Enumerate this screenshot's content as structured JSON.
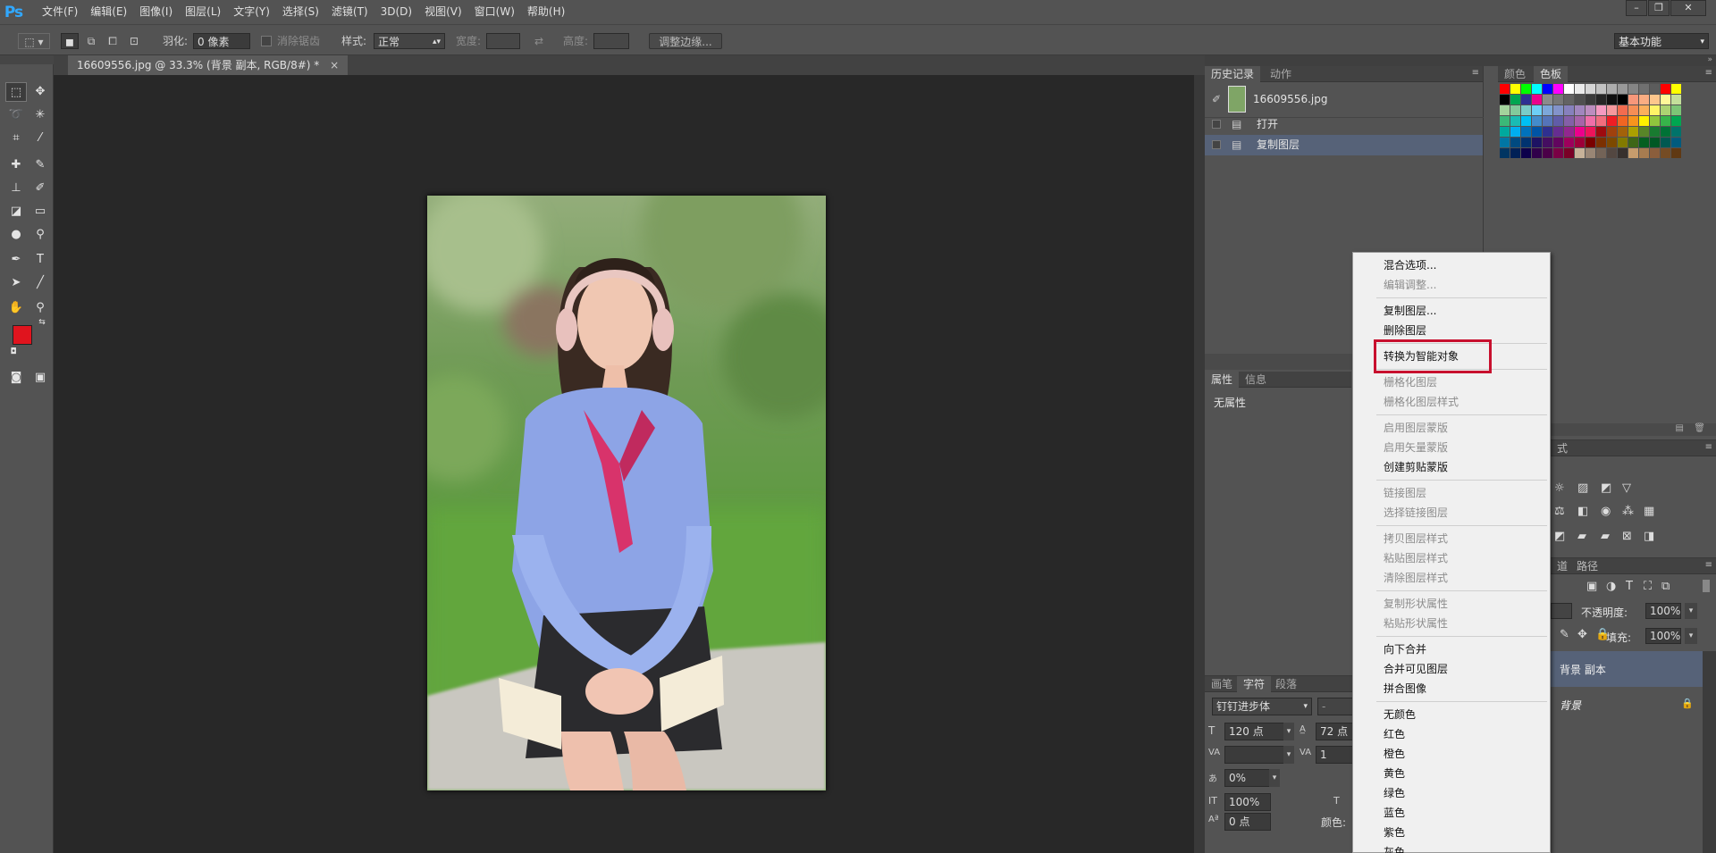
{
  "app": {
    "logo": "Ps"
  },
  "menu": [
    "文件(F)",
    "编辑(E)",
    "图像(I)",
    "图层(L)",
    "文字(Y)",
    "选择(S)",
    "滤镜(T)",
    "3D(D)",
    "视图(V)",
    "窗口(W)",
    "帮助(H)"
  ],
  "window_controls": {
    "minimize": "–",
    "restore": "❐",
    "close": "✕"
  },
  "options_bar": {
    "feather_label": "羽化:",
    "feather_value": "0 像素",
    "anti_alias_label": "消除锯齿",
    "style_label": "样式:",
    "style_value": "正常",
    "width_label": "宽度:",
    "height_label": "高度:",
    "refine_edge_button": "调整边缘...",
    "workspace_value": "基本功能"
  },
  "document": {
    "tab_title": "16609556.jpg @ 33.3% (背景 副本, RGB/8#) *",
    "close_glyph": "×"
  },
  "history_panel": {
    "tabs": [
      "历史记录",
      "动作"
    ],
    "snapshot_name": "16609556.jpg",
    "items": [
      "打开",
      "复制图层"
    ],
    "selected_index": 1
  },
  "swatches_panel": {
    "tabs": [
      "颜色",
      "色板"
    ]
  },
  "properties_panel": {
    "tabs": [
      "属性",
      "信息"
    ],
    "empty_text": "无属性"
  },
  "styles_panel": {
    "tab_tail": "式"
  },
  "layers_panel": {
    "tab_tail": "道",
    "tab_paths": "路径",
    "opacity_label": "不透明度:",
    "opacity_value": "100%",
    "fill_label": "填充:",
    "fill_value": "100%",
    "layers": [
      "背景 副本",
      "背景"
    ]
  },
  "character_panel": {
    "tabs": [
      "画笔",
      "字符",
      "段落"
    ],
    "font_family": "钉钉进步体",
    "font_style": "-",
    "font_size": "120 点",
    "leading": "72 点",
    "kerning": "",
    "tracking": "1",
    "tsume": "0%",
    "vertical_scale": "100%",
    "baseline_shift": "0 点",
    "color_label": "颜色:"
  },
  "context_menu": {
    "items": [
      {
        "label": "混合选项...",
        "enabled": true
      },
      {
        "label": "编辑调整...",
        "enabled": false
      },
      {
        "sep": true
      },
      {
        "label": "复制图层...",
        "enabled": true
      },
      {
        "label": "删除图层",
        "enabled": true
      },
      {
        "sep": true
      },
      {
        "label": "转换为智能对象",
        "enabled": true,
        "highlighted": true
      },
      {
        "sep": true
      },
      {
        "label": "栅格化图层",
        "enabled": false
      },
      {
        "label": "栅格化图层样式",
        "enabled": false
      },
      {
        "sep": true
      },
      {
        "label": "启用图层蒙版",
        "enabled": false
      },
      {
        "label": "启用矢量蒙版",
        "enabled": false
      },
      {
        "label": "创建剪贴蒙版",
        "enabled": true
      },
      {
        "sep": true
      },
      {
        "label": "链接图层",
        "enabled": false
      },
      {
        "label": "选择链接图层",
        "enabled": false
      },
      {
        "sep": true
      },
      {
        "label": "拷贝图层样式",
        "enabled": false
      },
      {
        "label": "粘贴图层样式",
        "enabled": false
      },
      {
        "label": "清除图层样式",
        "enabled": false
      },
      {
        "sep": true
      },
      {
        "label": "复制形状属性",
        "enabled": false
      },
      {
        "label": "粘贴形状属性",
        "enabled": false
      },
      {
        "sep": true
      },
      {
        "label": "向下合并",
        "enabled": true
      },
      {
        "label": "合并可见图层",
        "enabled": true
      },
      {
        "label": "拼合图像",
        "enabled": true
      },
      {
        "sep": true
      },
      {
        "label": "无颜色",
        "enabled": true
      },
      {
        "label": "红色",
        "enabled": true
      },
      {
        "label": "橙色",
        "enabled": true
      },
      {
        "label": "黄色",
        "enabled": true
      },
      {
        "label": "绿色",
        "enabled": true
      },
      {
        "label": "蓝色",
        "enabled": true
      },
      {
        "label": "紫色",
        "enabled": true
      },
      {
        "label": "灰色",
        "enabled": true
      }
    ]
  },
  "colors": {
    "foreground": "#e0141e",
    "background": "#ececec",
    "accent": "#31a8ff",
    "highlight_box": "#c8102e"
  }
}
